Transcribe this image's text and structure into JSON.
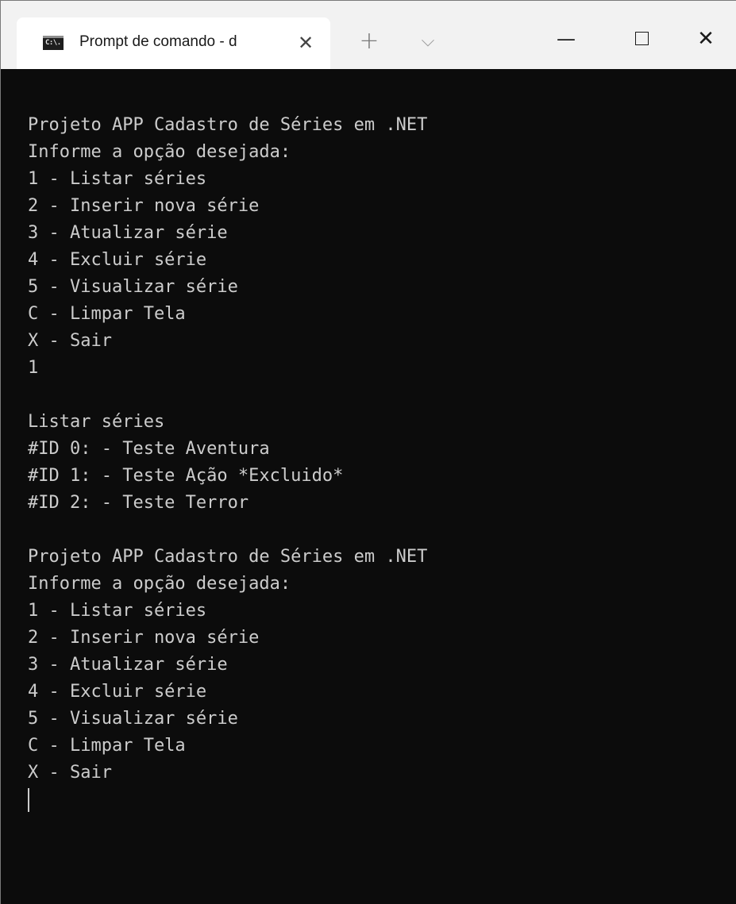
{
  "window": {
    "tab_title": "Prompt de comando - d",
    "tab_icon_text": "C:\\.",
    "close_tab_glyph": "✕",
    "new_tab_glyph": "+",
    "dropdown_glyph": "⌵",
    "minimize_glyph": "—",
    "close_glyph": "✕"
  },
  "console": {
    "lines": [
      "Projeto APP Cadastro de Séries em .NET",
      "Informe a opção desejada:",
      "1 - Listar séries",
      "2 - Inserir nova série",
      "3 - Atualizar série",
      "4 - Excluir série",
      "5 - Visualizar série",
      "C - Limpar Tela",
      "X - Sair",
      "1",
      "",
      "Listar séries",
      "#ID 0: - Teste Aventura",
      "#ID 1: - Teste Ação *Excluido*",
      "#ID 2: - Teste Terror",
      "",
      "Projeto APP Cadastro de Séries em .NET",
      "Informe a opção desejada:",
      "1 - Listar séries",
      "2 - Inserir nova série",
      "3 - Atualizar série",
      "4 - Excluir série",
      "5 - Visualizar série",
      "C - Limpar Tela",
      "X - Sair"
    ]
  }
}
